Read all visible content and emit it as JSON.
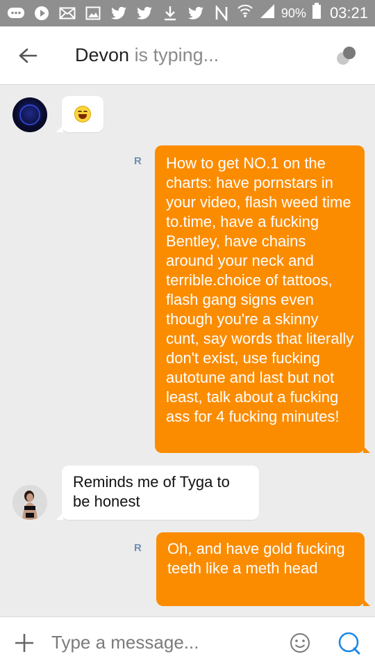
{
  "status_bar": {
    "battery_pct": "90%",
    "time": "03:21",
    "icons": [
      "chat-icon",
      "play-icon",
      "mail-icon",
      "gallery-icon",
      "twitter-icon",
      "twitter-icon",
      "download-icon",
      "twitter-icon",
      "nfc-icon",
      "wifi-icon",
      "signal-icon",
      "battery-icon"
    ]
  },
  "header": {
    "name": "Devon",
    "status": "is typing..."
  },
  "messages": [
    {
      "from": "them",
      "type": "emoji",
      "text": "😂"
    },
    {
      "from": "me",
      "read_mark": "R",
      "text": "How to get NO.1 on the charts: have pornstars in your video, flash weed time to.time, have a fucking Bentley, have chains around your neck and terrible.choice of tattoos, flash gang signs even though you're a skinny cunt, say words that literally don't exist, use fucking autotune and last but not least, talk about a fucking ass for 4 fucking minutes!"
    },
    {
      "from": "them",
      "text": "Reminds me of Tyga to be honest"
    },
    {
      "from": "me",
      "read_mark": "R",
      "text": "Oh, and have gold fucking teeth like a meth head"
    }
  ],
  "composer": {
    "placeholder": "Type a message..."
  },
  "colors": {
    "outgoing_bubble": "#fb8c00",
    "incoming_bubble": "#ffffff",
    "status_bar": "#8f8f8f",
    "send_icon": "#1e88e5"
  }
}
